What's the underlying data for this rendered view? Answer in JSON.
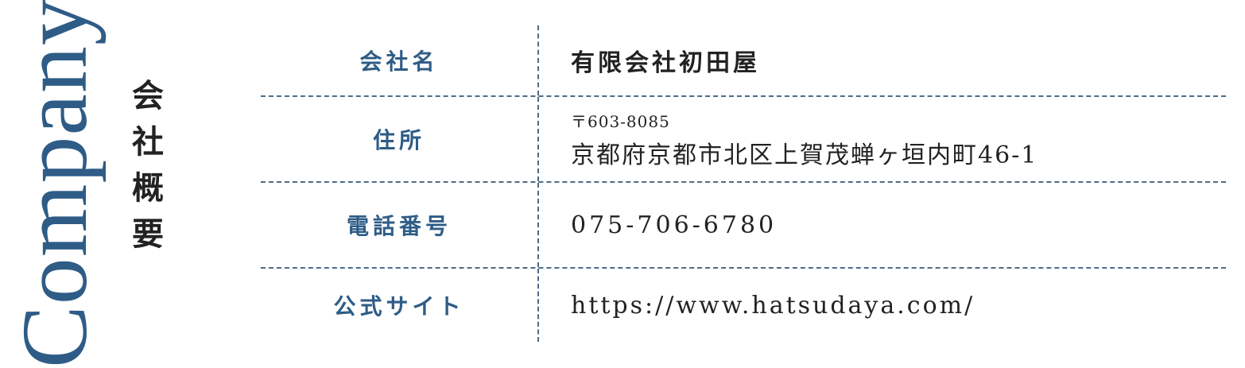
{
  "section": {
    "english_title": "Company",
    "japanese_title": [
      "会",
      "社",
      "概",
      "要"
    ]
  },
  "table": {
    "rows": [
      {
        "label": "会社名",
        "value": "有限会社初田屋"
      },
      {
        "label": "住所",
        "postal": "〒603-8085",
        "address": "京都府京都市北区上賀茂蝉ヶ垣内町46-1"
      },
      {
        "label": "電話番号",
        "value": "075-706-6780"
      },
      {
        "label": "公式サイト",
        "value": "https://www.hatsudaya.com/"
      }
    ]
  },
  "colors": {
    "accent_blue": "#2e5c86",
    "text_dark": "#222222",
    "divider": "#4c6b85"
  }
}
